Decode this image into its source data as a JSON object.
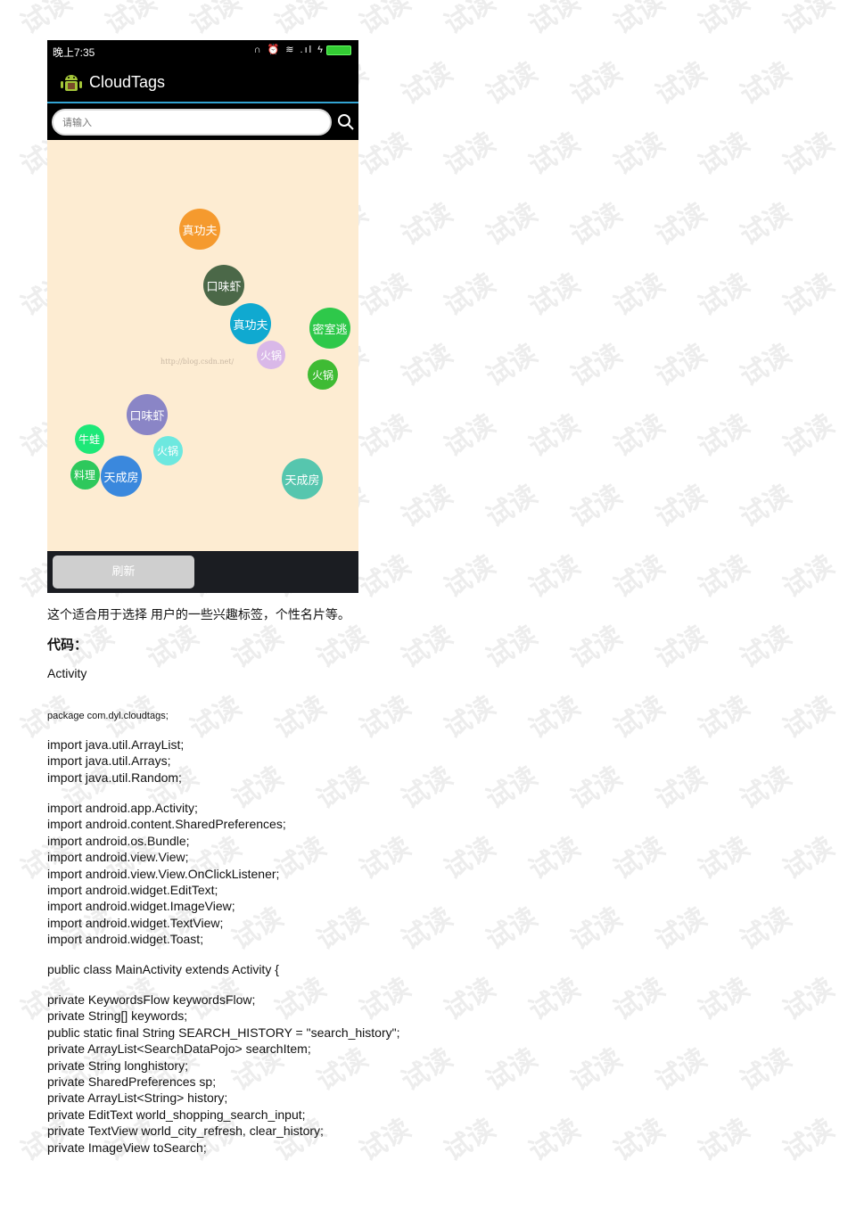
{
  "watermark_text": "试读",
  "phone": {
    "status_time": "晚上7:35",
    "status_icons": "∩ ⏰ ≋ .ıl ϟ",
    "app_title": "CloudTags",
    "search_placeholder": "请输入",
    "tag_watermark": "http://blog.csdn.net/",
    "tags": [
      {
        "label": "真功夫",
        "color": "#f59a2e"
      },
      {
        "label": "口味虾",
        "color": "#4b6848"
      },
      {
        "label": "真功夫",
        "color": "#10a9d0"
      },
      {
        "label": "密室逃",
        "color": "#2ec84a"
      },
      {
        "label": "火锅",
        "color": "#d9b8e8"
      },
      {
        "label": "火锅",
        "color": "#3fbb34"
      },
      {
        "label": "口味虾",
        "color": "#8a85c6"
      },
      {
        "label": "牛蛙",
        "color": "#1ee878"
      },
      {
        "label": "火锅",
        "color": "#6de8df"
      },
      {
        "label": "料理",
        "color": "#2ec85c"
      },
      {
        "label": "天成房",
        "color": "#3a88dd"
      },
      {
        "label": "天成房",
        "color": "#56c6ae"
      }
    ],
    "refresh_label": "刷新"
  },
  "document": {
    "caption": "这个适合用于选择 用户的一些兴趣标签，个性名片等。",
    "code_heading": "代码：",
    "activity_label": "Activity",
    "package_line": "package com.dyl.cloudtags;",
    "import_block_1": "import java.util.ArrayList;\nimport java.util.Arrays;\nimport java.util.Random;",
    "import_block_2": "import android.app.Activity;\nimport android.content.SharedPreferences;\nimport android.os.Bundle;\nimport android.view.View;\nimport android.view.View.OnClickListener;\nimport android.widget.EditText;\nimport android.widget.ImageView;\nimport android.widget.TextView;\nimport android.widget.Toast;",
    "class_decl": "public class MainActivity extends Activity {",
    "fields_block": "private KeywordsFlow keywordsFlow;\nprivate String[] keywords;\npublic static final String SEARCH_HISTORY = \"search_history\";\nprivate ArrayList<SearchDataPojo> searchItem;\nprivate String longhistory;\nprivate SharedPreferences sp;\nprivate ArrayList<String> history;\nprivate EditText world_shopping_search_input;\nprivate TextView world_city_refresh, clear_history;\nprivate ImageView toSearch;"
  }
}
